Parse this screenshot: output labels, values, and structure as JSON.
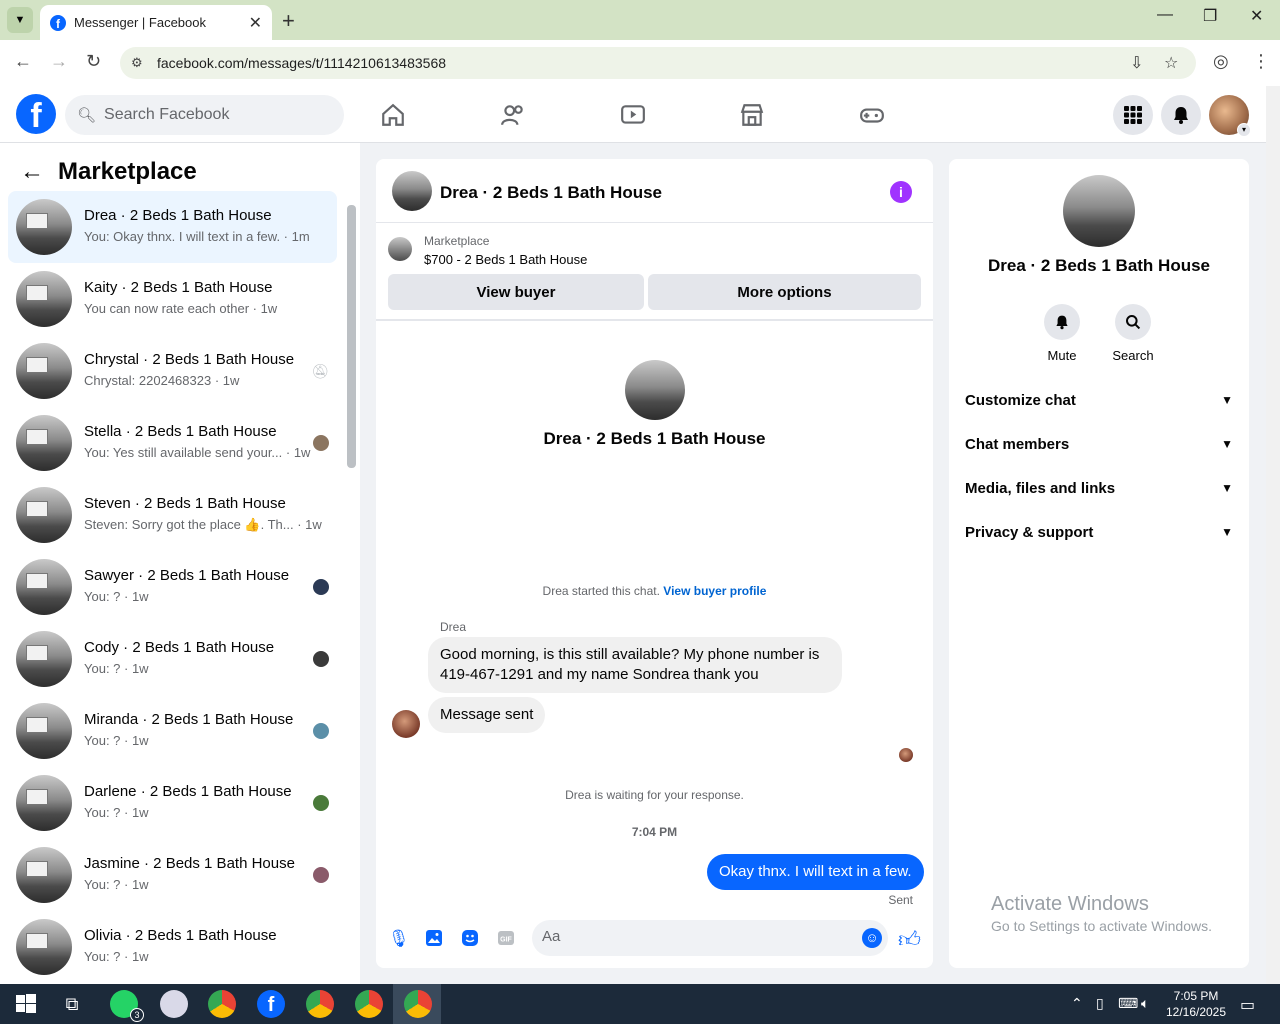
{
  "browser": {
    "tab_title": "Messenger | Facebook",
    "url": "facebook.com/messages/t/1114210613483568"
  },
  "fb": {
    "search_placeholder": "Search Facebook"
  },
  "left": {
    "title": "Marketplace",
    "conversations": [
      {
        "name": "Drea · 2 Beds 1 Bath House",
        "preview": "You: Okay thnx. I will text in a few. · 1m"
      },
      {
        "name": "Kaity · 2 Beds 1 Bath House",
        "preview": "You can now rate each other · 1w"
      },
      {
        "name": "Chrystal · 2 Beds 1 Bath House",
        "preview": "Chrystal: 2202468323 · 1w"
      },
      {
        "name": "Stella · 2 Beds 1 Bath House",
        "preview": "You: Yes still available send your... · 1w"
      },
      {
        "name": "Steven · 2 Beds 1 Bath House",
        "preview": "Steven: Sorry got the place 👍. Th... · 1w"
      },
      {
        "name": "Sawyer · 2 Beds 1 Bath House",
        "preview": "You: ? · 1w"
      },
      {
        "name": "Cody · 2 Beds 1 Bath House",
        "preview": "You: ? · 1w"
      },
      {
        "name": "Miranda · 2 Beds 1 Bath House",
        "preview": "You: ? · 1w"
      },
      {
        "name": "Darlene · 2 Beds 1 Bath House",
        "preview": "You: ? · 1w"
      },
      {
        "name": "Jasmine · 2 Beds 1 Bath House",
        "preview": "You: ? · 1w"
      },
      {
        "name": "Olivia · 2 Beds 1 Bath House",
        "preview": "You: ? · 1w"
      }
    ]
  },
  "chat": {
    "title": "Drea · 2 Beds 1 Bath House",
    "marketplace_label": "Marketplace",
    "listing": "$700 - 2 Beds 1 Bath House",
    "view_buyer": "View buyer",
    "more_options": "More options",
    "profile_name": "Drea · 2 Beds 1 Bath House",
    "started_text": "Drea started this chat.",
    "view_buyer_profile": "View buyer profile",
    "sender": "Drea",
    "msg1": "Good morning, is this still available? My phone number is 419-467-1291 and my name Sondrea thank you",
    "msg2": "Message sent",
    "waiting": "Drea is waiting for your response.",
    "time": "7:04 PM",
    "msg_out": "Okay thnx. I will text in a few.",
    "sent": "Sent",
    "input_placeholder": "Aa"
  },
  "right": {
    "name": "Drea · 2 Beds 1 Bath House",
    "mute": "Mute",
    "search": "Search",
    "rows": [
      "Customize chat",
      "Chat members",
      "Media, files and links",
      "Privacy & support"
    ],
    "activate_title": "Activate Windows",
    "activate_sub": "Go to Settings to activate Windows."
  },
  "taskbar": {
    "time": "7:05 PM",
    "date": "12/16/2025",
    "whatsapp_badge": "3"
  }
}
